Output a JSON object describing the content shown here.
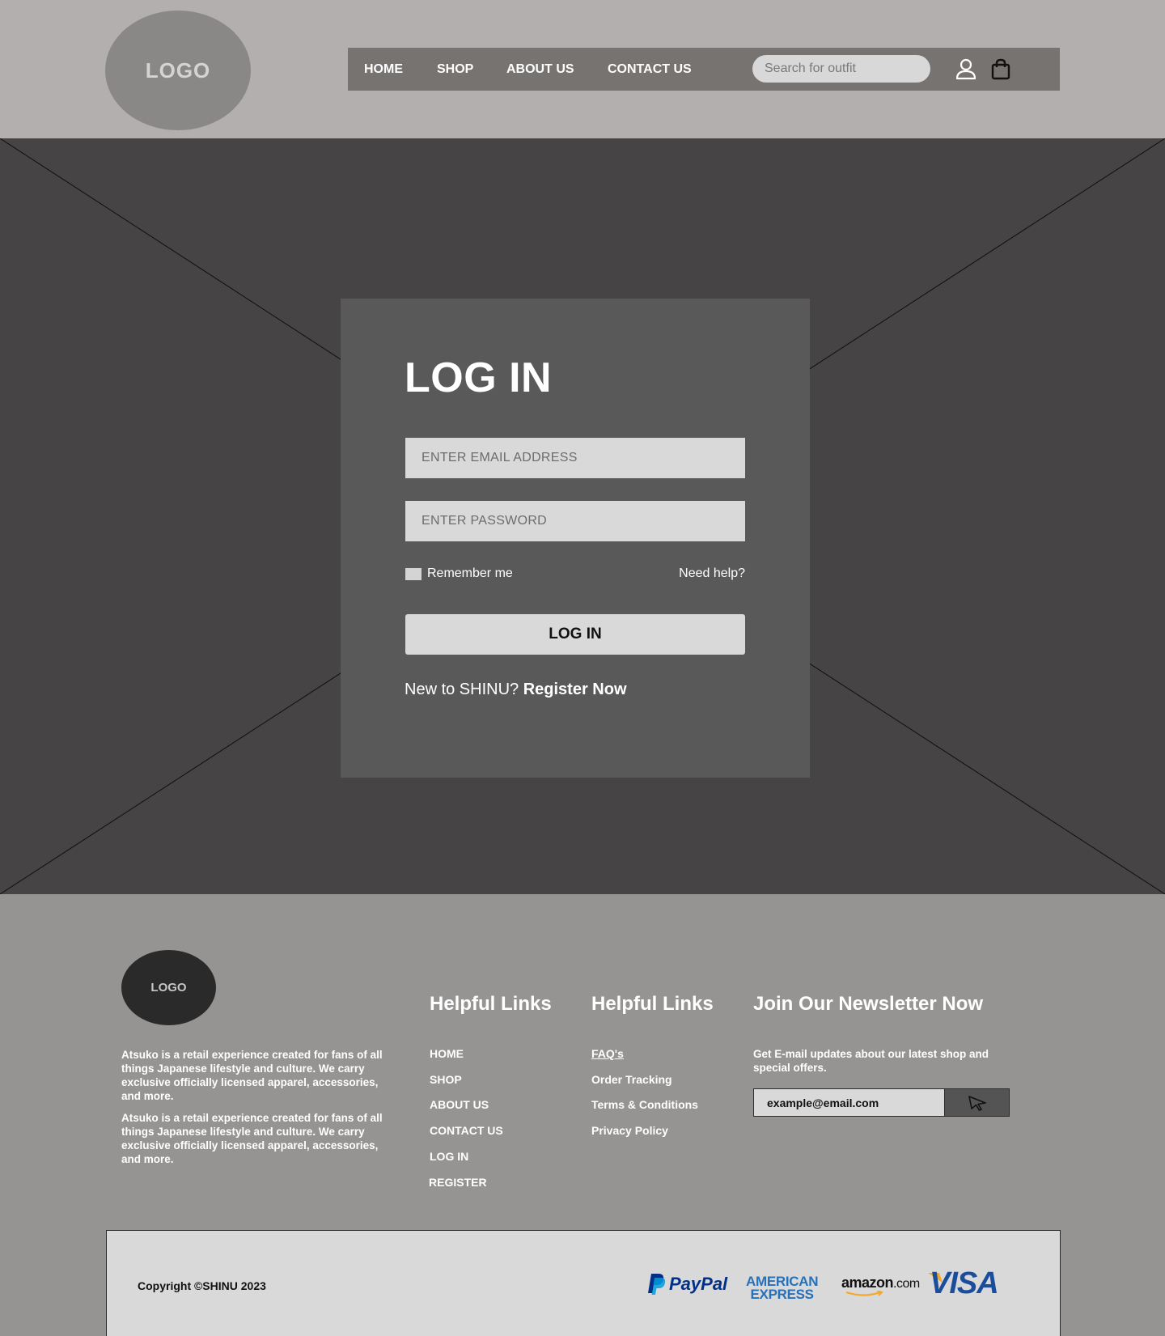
{
  "header": {
    "logo": "LOGO",
    "nav": [
      "HOME",
      "SHOP",
      "ABOUT US",
      "CONTACT US"
    ],
    "search_placeholder": "Search for outfit",
    "icons": [
      "user-icon",
      "shopping-bag-icon"
    ]
  },
  "login": {
    "title": "LOG IN",
    "email_placeholder": "ENTER EMAIL ADDRESS",
    "password_placeholder": "ENTER PASSWORD",
    "remember": "Remember me",
    "help": "Need help?",
    "button": "LOG IN",
    "register_prefix": "New to SHINU? ",
    "register_link": "Register Now"
  },
  "footer": {
    "logo": "LOGO",
    "about": [
      "Atsuko is a retail experience created for fans of all things Japanese lifestyle and culture. We carry exclusive officially licensed apparel, accessories, and more.",
      "Atsuko is a retail experience created for fans of all things Japanese lifestyle and culture. We carry exclusive officially licensed apparel, accessories, and more."
    ],
    "col1": {
      "title": "Helpful Links",
      "links": [
        "HOME",
        "SHOP",
        "ABOUT US",
        "CONTACT US",
        "LOG IN",
        "REGISTER"
      ]
    },
    "col2": {
      "title": "Helpful Links",
      "links": [
        "FAQ's",
        "Order Tracking",
        "Terms & Conditions",
        "Privacy Policy"
      ]
    },
    "newsletter": {
      "title": "Join Our Newsletter Now",
      "text": "Get E-mail updates about our latest shop and special offers.",
      "input_value": "example@email.com",
      "send_icon": "send-cursor-icon"
    },
    "copyright": "Copyright ©SHINU 2023",
    "payments": {
      "paypal": "PayPal",
      "amex_line1": "AMERICAN",
      "amex_line2": "EXPRESS",
      "amazon": "amazon",
      "amazon_suffix": ".com",
      "visa": "VISA"
    }
  },
  "colors": {
    "header_bg": "#b2afae",
    "nav_bg": "#767371",
    "hero_bg": "#464445",
    "card_bg": "#5a5959",
    "footer_bg": "#959493",
    "paypal_dark": "#003087",
    "paypal_light": "#009cde",
    "amex_blue": "#2671b9",
    "visa_blue": "#1a4e9c",
    "visa_gold": "#f7a823"
  }
}
